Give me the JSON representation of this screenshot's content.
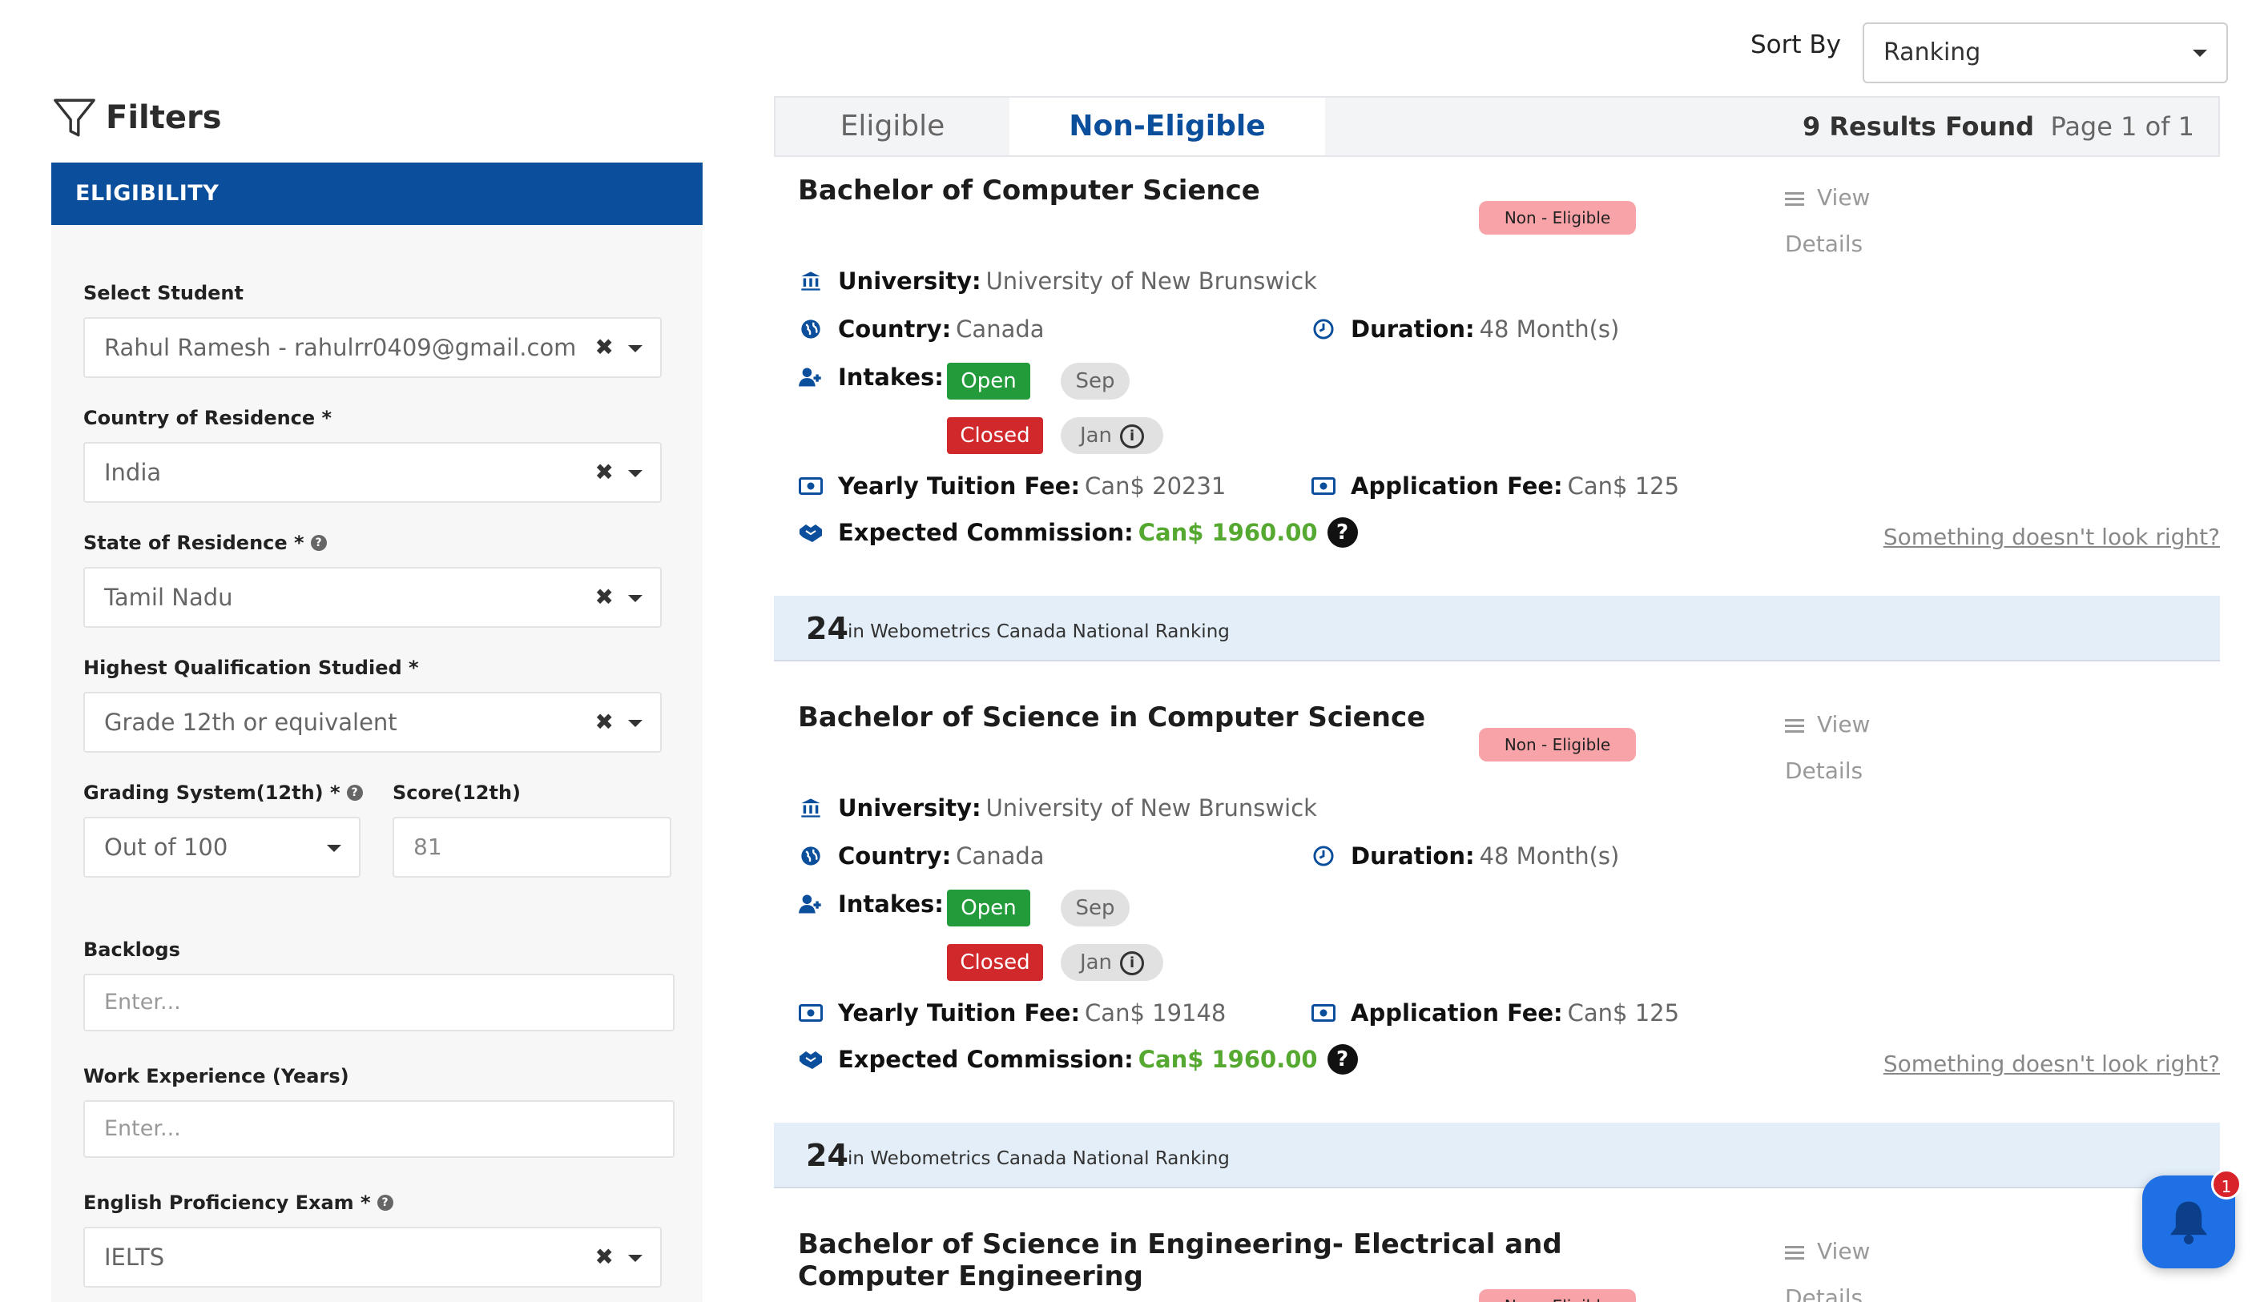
{
  "filters": {
    "title": "Filters",
    "eligibility_header": "ELIGIBILITY",
    "select_student": {
      "label": "Select Student",
      "value": "Rahul Ramesh - rahulrr0409@gmail.com"
    },
    "country_of_residence": {
      "label": "Country of Residence *",
      "value": "India"
    },
    "state_of_residence": {
      "label": "State of Residence *",
      "value": "Tamil Nadu"
    },
    "highest_qualification": {
      "label": "Highest Qualification Studied *",
      "value": "Grade 12th or equivalent"
    },
    "grading_system": {
      "label": "Grading System(12th) *",
      "value": "Out of 100"
    },
    "score": {
      "label": "Score(12th)",
      "value": "81"
    },
    "backlogs": {
      "label": "Backlogs",
      "placeholder": "Enter..."
    },
    "work_experience": {
      "label": "Work Experience (Years)",
      "placeholder": "Enter..."
    },
    "english_exam": {
      "label": "English Proficiency Exam *",
      "value": "IELTS"
    },
    "clear_glyph": "✖"
  },
  "sort": {
    "label": "Sort By",
    "value": "Ranking"
  },
  "tabs": {
    "eligible": "Eligible",
    "non_eligible": "Non-Eligible"
  },
  "results_found": "9 Results Found",
  "page_info": "Page 1 of 1",
  "labels": {
    "badge": "Non - Eligible",
    "view": "View",
    "details": "Details",
    "university": "University:",
    "country": "Country:",
    "duration": "Duration:",
    "intakes": "Intakes:",
    "yearly_tuition": "Yearly Tuition Fee:",
    "application_fee": "Application Fee:",
    "expected_commission": "Expected Commission:",
    "report": "Something doesn't look right?",
    "rank_text": "in Webometrics Canada National Ranking",
    "info_glyph": "i",
    "question_glyph": "?"
  },
  "programs": [
    {
      "title": "Bachelor of Computer Science",
      "university": "University of New Brunswick",
      "country": "Canada",
      "duration": "48 Month(s)",
      "intake_open": "Open",
      "intake_open_month": "Sep",
      "intake_closed": "Closed",
      "intake_closed_month": "Jan",
      "tuition": "Can$ 20231",
      "application_fee": "Can$ 125",
      "commission": "Can$ 1960.00",
      "rank": "24"
    },
    {
      "title": "Bachelor of Science in Computer Science",
      "university": "University of New Brunswick",
      "country": "Canada",
      "duration": "48 Month(s)",
      "intake_open": "Open",
      "intake_open_month": "Sep",
      "intake_closed": "Closed",
      "intake_closed_month": "Jan",
      "tuition": "Can$ 19148",
      "application_fee": "Can$ 125",
      "commission": "Can$ 1960.00",
      "rank": "24"
    },
    {
      "title_line1": "Bachelor of Science in Engineering- Electrical and",
      "title_line2": "Computer Engineering"
    }
  ],
  "notification_count": "1",
  "colors": {
    "brand_blue": "#0b4e9c",
    "open_green": "#239b3a",
    "closed_red": "#d0282b",
    "commission_green": "#55a830",
    "badge_pink": "#f8a3a8"
  },
  "icons": [
    "filter-icon",
    "university-icon",
    "globe-icon",
    "clock-icon",
    "user-plus-icon",
    "money-icon",
    "handshake-icon",
    "list-icon",
    "bell-icon",
    "info-icon",
    "question-icon",
    "chevron-down-icon",
    "clear-icon"
  ]
}
